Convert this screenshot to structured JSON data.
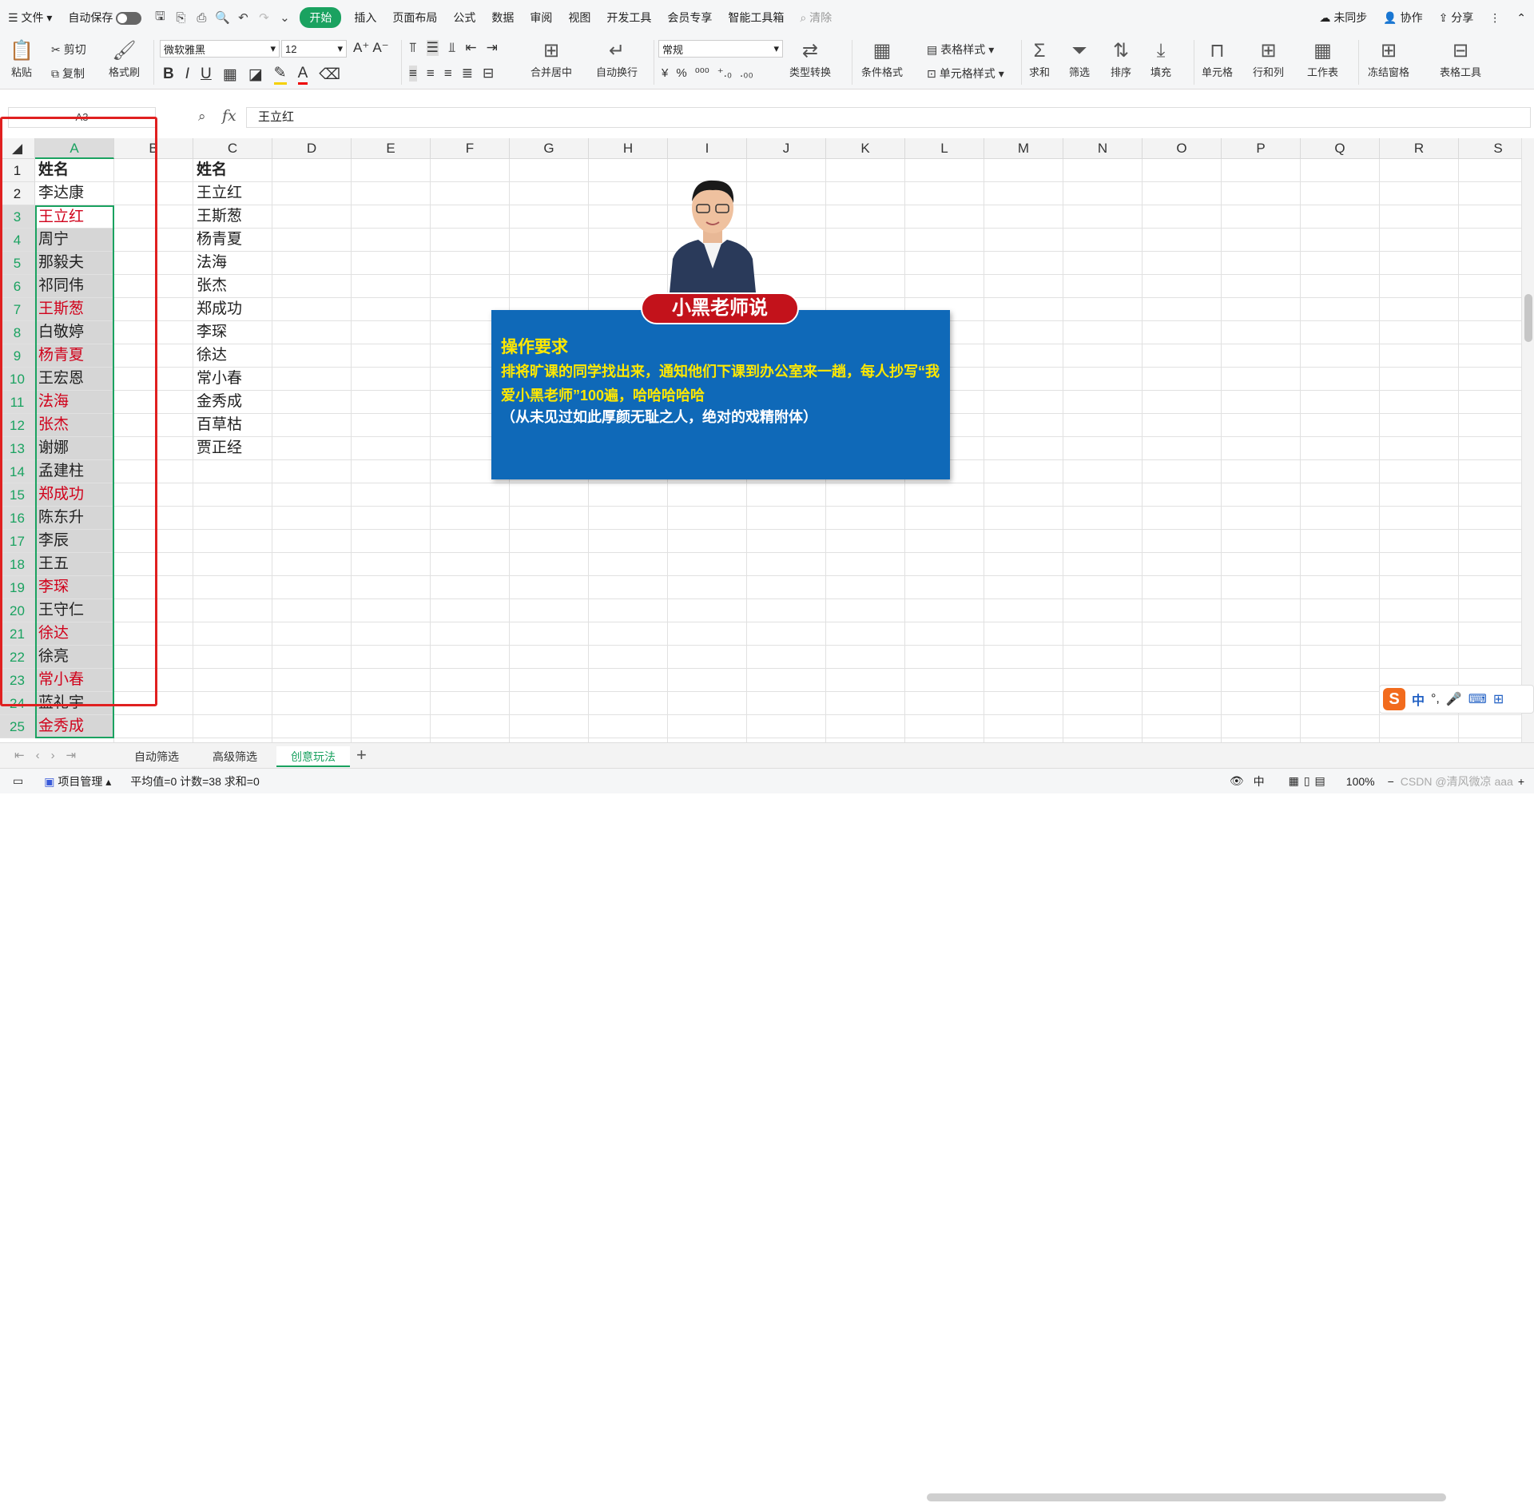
{
  "menubar": {
    "file": "文件",
    "autosave": "自动保存",
    "tabs": [
      "开始",
      "插入",
      "页面布局",
      "公式",
      "数据",
      "审阅",
      "视图",
      "开发工具",
      "会员专享",
      "智能工具箱"
    ],
    "search_placeholder": "清除",
    "sync": "未同步",
    "collab": "协作",
    "share": "分享"
  },
  "ribbon": {
    "paste": "粘贴",
    "cut": "剪切",
    "copy": "复制",
    "format_painter": "格式刷",
    "font_name": "微软雅黑",
    "font_size": "12",
    "merge_center": "合并居中",
    "wrap_text": "自动换行",
    "number_format": "常规",
    "type_convert": "类型转换",
    "cond_format": "条件格式",
    "table_style": "表格样式",
    "cell_style": "单元格样式",
    "sum": "求和",
    "filter": "筛选",
    "sort": "排序",
    "fill": "填充",
    "cell": "单元格",
    "row_col": "行和列",
    "worksheet": "工作表",
    "freeze": "冻结窗格",
    "table_tools": "表格工具"
  },
  "formula_bar": {
    "namebox": "A3",
    "fx": "fx",
    "content": "王立红"
  },
  "columns": [
    "A",
    "B",
    "C",
    "D",
    "E",
    "F",
    "G",
    "H",
    "I",
    "J",
    "K",
    "L",
    "M",
    "N",
    "O",
    "P",
    "Q",
    "R",
    "S"
  ],
  "rows": [
    "1",
    "2",
    "3",
    "4",
    "5",
    "6",
    "7",
    "8",
    "9",
    "10",
    "11",
    "12",
    "13",
    "14",
    "15",
    "16",
    "17",
    "18",
    "19",
    "20",
    "21",
    "22",
    "23",
    "24",
    "25"
  ],
  "colA": [
    {
      "text": "姓名",
      "style": "bold"
    },
    {
      "text": "李达康",
      "style": "plain"
    },
    {
      "text": "王立红",
      "style": "red"
    },
    {
      "text": "周宁",
      "style": "plain"
    },
    {
      "text": "那毅夫",
      "style": "plain"
    },
    {
      "text": "祁同伟",
      "style": "plain"
    },
    {
      "text": "王斯葱",
      "style": "red"
    },
    {
      "text": "白敬婷",
      "style": "plain"
    },
    {
      "text": "杨青夏",
      "style": "red"
    },
    {
      "text": "王宏恩",
      "style": "plain"
    },
    {
      "text": "法海",
      "style": "red"
    },
    {
      "text": "张杰",
      "style": "red"
    },
    {
      "text": "谢娜",
      "style": "plain"
    },
    {
      "text": "孟建柱",
      "style": "plain"
    },
    {
      "text": "郑成功",
      "style": "red"
    },
    {
      "text": "陈东升",
      "style": "plain"
    },
    {
      "text": "李辰",
      "style": "plain"
    },
    {
      "text": "王五",
      "style": "plain"
    },
    {
      "text": "李琛",
      "style": "red"
    },
    {
      "text": "王守仁",
      "style": "plain"
    },
    {
      "text": "徐达",
      "style": "red"
    },
    {
      "text": "徐亮",
      "style": "plain"
    },
    {
      "text": "常小春",
      "style": "red"
    },
    {
      "text": "蓝礼宇",
      "style": "plain"
    },
    {
      "text": "金秀成",
      "style": "red"
    }
  ],
  "colC": [
    "姓名",
    "王立红",
    "王斯葱",
    "杨青夏",
    "法海",
    "张杰",
    "郑成功",
    "李琛",
    "徐达",
    "常小春",
    "金秀成",
    "百草枯",
    "贾正经"
  ],
  "card": {
    "badge": "小黑老师说",
    "title": "操作要求",
    "line1": "排将旷课的同学找出来，通知他们下课到办公室来一趟，每人抄写“我爱小黑老师”100遍，哈哈哈哈哈",
    "line2": "（从未见过如此厚颜无耻之人，绝对的戏精附体）"
  },
  "sheets": [
    "自动筛选",
    "高级筛选",
    "创意玩法"
  ],
  "active_sheet": "创意玩法",
  "status": {
    "project": "项目管理",
    "stats": "平均值=0  计数=38  求和=0",
    "input_mode": "中",
    "zoom": "100%",
    "watermark": "CSDN @清风微凉 aaa"
  },
  "ime": {
    "lang": "中"
  },
  "colors": {
    "accent": "#1aa260",
    "red_text": "#d0021b",
    "card_bg": "#0f69b8",
    "badge": "#c3121b",
    "card_title": "#ffe800"
  }
}
